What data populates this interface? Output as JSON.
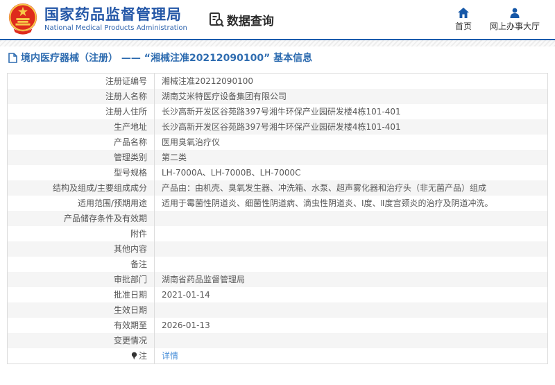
{
  "header": {
    "logo_title": "国家药品监督管理局",
    "logo_subtitle": "National Medical Products Administration",
    "section_title": "数据查询",
    "nav": [
      {
        "label": "首页"
      },
      {
        "label": "网上办事大厅"
      }
    ]
  },
  "breadcrumb": {
    "text": "境内医疗器械（注册） —— “湘械注准20212090100” 基本信息"
  },
  "table": {
    "rows": [
      {
        "label": "注册证编号",
        "value": "湘械注准20212090100"
      },
      {
        "label": "注册人名称",
        "value": "湖南艾米特医疗设备集团有限公司"
      },
      {
        "label": "注册人住所",
        "value": "长沙高新开发区谷苑路397号湘牛环保产业园研发楼4栋101-401"
      },
      {
        "label": "生产地址",
        "value": "长沙高新开发区谷苑路397号湘牛环保产业园研发楼4栋101-401"
      },
      {
        "label": "产品名称",
        "value": "医用臭氧治疗仪"
      },
      {
        "label": "管理类别",
        "value": "第二类"
      },
      {
        "label": "型号规格",
        "value": "LH-7000A、LH-7000B、LH-7000C"
      },
      {
        "label": "结构及组成/主要组成成分",
        "value": "产品由：由机壳、臭氧发生器、冲洗箱、水泵、超声雾化器和治疗头（非无菌产品）组成"
      },
      {
        "label": "适用范围/预期用途",
        "value": "适用于霉菌性阴道炎、细菌性阴道病、滴虫性阴道炎、Ⅰ度、Ⅱ度宫颈炎的治疗及阴道冲洗。"
      },
      {
        "label": "产品储存条件及有效期",
        "value": ""
      },
      {
        "label": "附件",
        "value": ""
      },
      {
        "label": "其他内容",
        "value": ""
      },
      {
        "label": "备注",
        "value": ""
      },
      {
        "label": "审批部门",
        "value": "湖南省药品监督管理局"
      },
      {
        "label": "批准日期",
        "value": "2021-01-14"
      },
      {
        "label": "生效日期",
        "value": ""
      },
      {
        "label": "有效期至",
        "value": "2026-01-13"
      },
      {
        "label": "变更情况",
        "value": ""
      },
      {
        "label": "注",
        "value": "详情",
        "value_is_link": true,
        "label_has_icon": true
      }
    ]
  },
  "colors": {
    "accent_blue": "#1b5cad",
    "title_blue": "#2457a7",
    "breadcrumb_blue": "#2e6cb0",
    "link_blue": "#4a90d9",
    "row_stripe": "#f5f5f5",
    "table_border": "#dcdcdc",
    "emblem_red": "#de2b1c",
    "emblem_gold": "#f7c948"
  }
}
